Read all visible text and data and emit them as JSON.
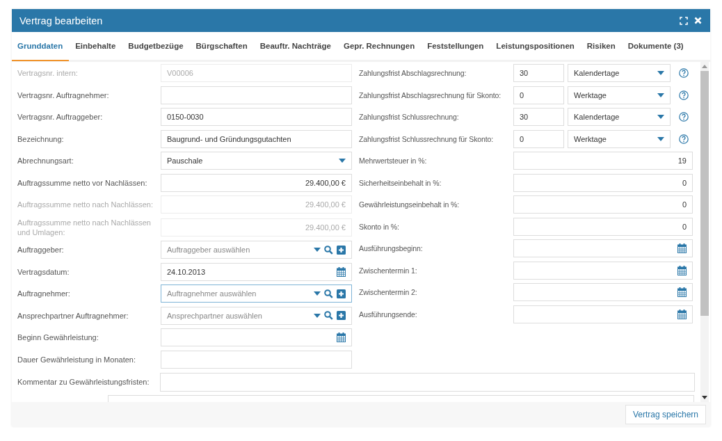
{
  "window": {
    "title": "Vertrag bearbeiten"
  },
  "tabs": [
    {
      "label": "Grunddaten",
      "selected": true
    },
    {
      "label": "Einbehalte",
      "selected": false
    },
    {
      "label": "Budgetbezüge",
      "selected": false
    },
    {
      "label": "Bürgschaften",
      "selected": false
    },
    {
      "label": "Beauftr. Nachträge",
      "selected": false
    },
    {
      "label": "Gepr. Rechnungen",
      "selected": false
    },
    {
      "label": "Feststellungen",
      "selected": false
    },
    {
      "label": "Leistungspositionen",
      "selected": false
    },
    {
      "label": "Risiken",
      "selected": false
    },
    {
      "label": "Dokumente (3)",
      "selected": false
    }
  ],
  "left_fields": [
    {
      "label": "Vertragsnr. intern:",
      "kind": "text",
      "value": "V00006",
      "disabled": true,
      "focused": false
    },
    {
      "label": "Vertragsnr. Auftragnehmer:",
      "kind": "text",
      "disabled": false,
      "focused": false
    },
    {
      "label": "Vertragsnr. Auftraggeber:",
      "kind": "text",
      "value": "0150-0030",
      "disabled": false,
      "focused": false
    },
    {
      "label": "Bezeichnung:",
      "kind": "text",
      "value": "Baugrund- und Gründungsgutachten",
      "disabled": false,
      "focused": false
    },
    {
      "label": "Abrechnungsart:",
      "kind": "select",
      "value": "Pauschale",
      "disabled": false,
      "focused": false
    },
    {
      "label": "Auftragssumme netto vor Nachlässen:",
      "kind": "amount",
      "value": "29.400,00 €",
      "disabled": false,
      "focused": false
    },
    {
      "label": "Auftragssumme netto nach Nachlässen:",
      "kind": "amount",
      "value": "29.400,00 €",
      "disabled": true,
      "focused": false
    },
    {
      "label": "Auftragssumme netto nach Nachlässen und Umlagen:",
      "kind": "amount",
      "value": "29.400,00 €",
      "disabled": true,
      "focused": false
    },
    {
      "label": "Auftraggeber:",
      "kind": "picker",
      "placeholder": "Auftraggeber auswählen",
      "disabled": false,
      "focused": false
    },
    {
      "label": "Vertragsdatum:",
      "kind": "date",
      "value": "24.10.2013",
      "disabled": false,
      "focused": false
    },
    {
      "label": "Auftragnehmer:",
      "kind": "picker",
      "placeholder": "Auftragnehmer auswählen",
      "disabled": false,
      "focused": true
    },
    {
      "label": "Ansprechpartner Auftragnehmer:",
      "kind": "picker",
      "placeholder": "Ansprechpartner auswählen",
      "disabled": false,
      "focused": false
    },
    {
      "label": "Beginn Gewährleistung:",
      "kind": "date",
      "disabled": false,
      "focused": false
    },
    {
      "label": "Dauer Gewährleistung in Monaten:",
      "kind": "text",
      "disabled": false,
      "focused": false
    }
  ],
  "right_fields": [
    {
      "label": "Zahlungsfrist Abschlagsrechnung:",
      "kind": "term",
      "value": "30",
      "unit": "Kalendertage"
    },
    {
      "label": "Zahlungsfrist Abschlagsrechnung für Skonto:",
      "kind": "term",
      "value": "0",
      "unit": "Werktage"
    },
    {
      "label": "Zahlungsfrist Schlussrechnung:",
      "kind": "term",
      "value": "30",
      "unit": "Kalendertage"
    },
    {
      "label": "Zahlungsfrist Schlussrechnung für Skonto:",
      "kind": "term",
      "value": "0",
      "unit": "Werktage"
    },
    {
      "label": "Mehrwertsteuer in %:",
      "kind": "number",
      "value": "19"
    },
    {
      "label": "Sicherheitseinbehalt in %:",
      "kind": "number",
      "value": "0"
    },
    {
      "label": "Gewährleistungseinbehalt in %:",
      "kind": "number",
      "value": "0"
    },
    {
      "label": "Skonto in %:",
      "kind": "number",
      "value": "0"
    },
    {
      "label": "Ausführungsbeginn:",
      "kind": "date"
    },
    {
      "label": "Zwischentermin 1:",
      "kind": "date"
    },
    {
      "label": "Zwischentermin 2:",
      "kind": "date"
    },
    {
      "label": "Ausführungsende:",
      "kind": "date"
    }
  ],
  "comment": {
    "label": "Kommentar zu Gewährleistungsfristen:"
  },
  "footer": {
    "save_button": "Vertrag speichern"
  }
}
